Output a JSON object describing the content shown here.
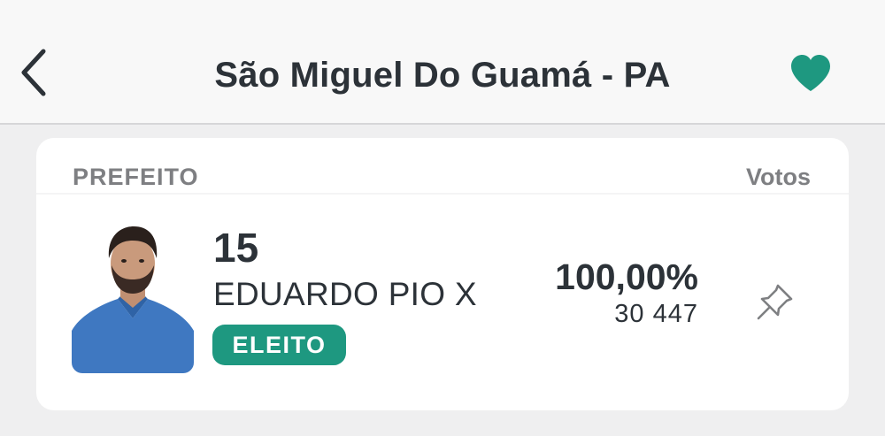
{
  "header": {
    "back_icon": "chevron-left-icon",
    "title": "São Miguel Do Guamá - PA",
    "favorite_icon": "heart-icon",
    "accent_color": "#1e9880"
  },
  "card": {
    "role_label": "PREFEITO",
    "votes_header": "Votos",
    "candidate": {
      "photo": "candidate-photo",
      "number": "15",
      "name": "EDUARDO PIO X",
      "status_badge": "ELEITO",
      "percentage": "100,00%",
      "votes": "30 447",
      "pin_icon": "pin-icon"
    }
  }
}
